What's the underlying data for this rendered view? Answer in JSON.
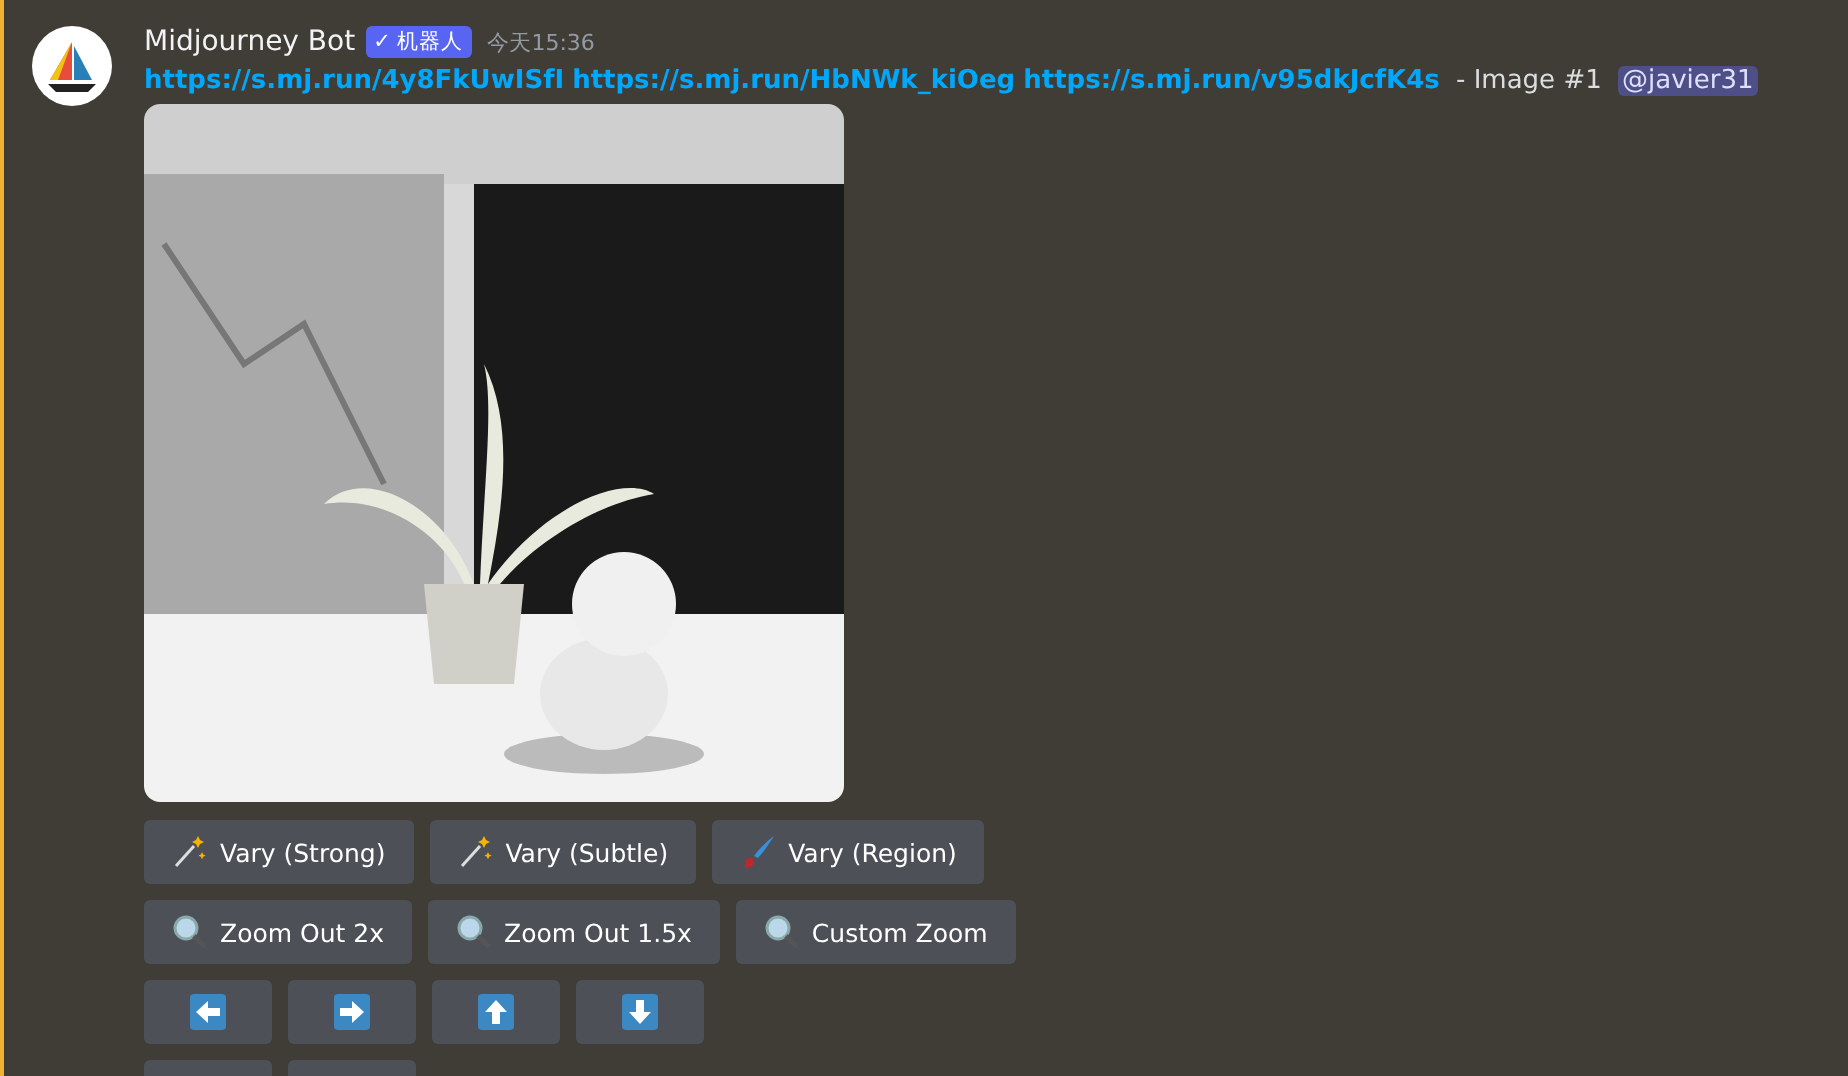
{
  "message": {
    "author": "Midjourney Bot",
    "badge": "✓ 机器人",
    "time": "今天15:36",
    "links": [
      "https://s.mj.run/4y8FkUwISfI",
      "https://s.mj.run/HbNWk_kiOeg",
      "https://s.mj.run/v95dkJcfK4s"
    ],
    "suffix": " - Image #1 ",
    "mention": "@javier31",
    "image": {
      "kind": "picture"
    },
    "button_rows": [
      [
        {
          "kind": "wand",
          "label": "Vary (Strong)"
        },
        {
          "kind": "wand",
          "label": "Vary (Subtle)"
        },
        {
          "kind": "brush",
          "label": "Vary (Region)"
        }
      ],
      [
        {
          "kind": "zoom",
          "label": "Zoom Out 2x"
        },
        {
          "kind": "zoom",
          "label": "Zoom Out 1.5x"
        },
        {
          "kind": "zoom",
          "label": "Custom Zoom"
        }
      ],
      [
        {
          "kind": "left"
        },
        {
          "kind": "right"
        },
        {
          "kind": "up"
        },
        {
          "kind": "down"
        }
      ],
      [
        {
          "kind": "blank"
        },
        {
          "kind": "blank"
        }
      ]
    ]
  }
}
